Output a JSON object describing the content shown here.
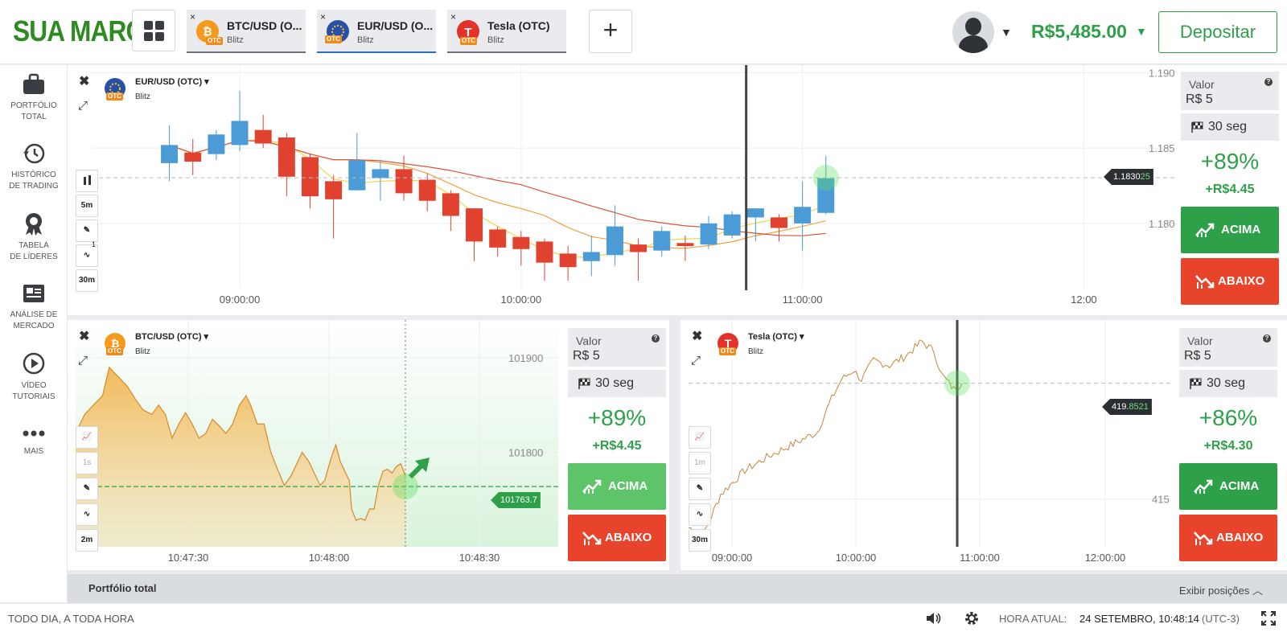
{
  "brand": {
    "logo": "SUA MARCA"
  },
  "tabs": [
    {
      "name": "BTC/USD (O...",
      "sub": "Blitz",
      "otc": "OTC"
    },
    {
      "name": "EUR/USD (O...",
      "sub": "Blitz",
      "otc": "OTC"
    },
    {
      "name": "Tesla (OTC)",
      "sub": "Blitz",
      "otc": "OTC"
    }
  ],
  "header": {
    "add_label": "+",
    "balance": "R$5,485.00",
    "deposit_label": "Depositar",
    "tab_close": "×"
  },
  "sidebar": {
    "items": [
      {
        "label1": "PORTFÓLIO",
        "label2": "TOTAL"
      },
      {
        "label1": "HISTÓRICO",
        "label2": "DE TRADING"
      },
      {
        "label1": "TABELA",
        "label2": "DE LÍDERES"
      },
      {
        "label1": "ANÁLISE DE",
        "label2": "MERCADO"
      },
      {
        "label1": "VÍDEO",
        "label2": "TUTORIAIS"
      },
      {
        "label1": "MAIS",
        "label2": ""
      }
    ]
  },
  "common": {
    "close": "✖",
    "expand": "⤢",
    "valor_label": "Valor",
    "help": "?",
    "up_label": "ACIMA",
    "down_label": "ABAIXO"
  },
  "panels": {
    "eurusd": {
      "name": "EUR/USD (OTC)",
      "sub": "Blitz",
      "otc": "OTC",
      "tools": [
        "5m",
        "30m"
      ],
      "tool_badge": "1",
      "price_prefix": "1.1830",
      "price_suffix": "25",
      "amount": "R$ 5",
      "duration": "30 seg",
      "payout": "+89%",
      "profit": "+R$4.45"
    },
    "btcusd": {
      "name": "BTC/USD (OTC)",
      "sub": "Blitz",
      "otc": "OTC",
      "tools": [
        "1s",
        "2m"
      ],
      "price_prefix": "1017",
      "price_suffix": "63.7",
      "amount": "R$ 5",
      "duration": "30 seg",
      "payout": "+89%",
      "profit": "+R$4.45"
    },
    "tesla": {
      "name": "Tesla (OTC)",
      "sub": "Blitz",
      "otc": "OTC",
      "tools": [
        "1m",
        "30m"
      ],
      "price_prefix": "419.",
      "price_suffix": "8521",
      "amount": "R$ 5",
      "duration": "30 seg",
      "payout": "+86%",
      "profit": "+R$4.30"
    }
  },
  "chart_data": [
    {
      "type": "candlestick",
      "series_name": "EUR/USD (OTC)",
      "x_ticks": [
        "09:00:00",
        "10:00:00",
        "11:00:00",
        "12:00"
      ],
      "y_ticks": [
        1.19,
        1.185,
        1.18
      ],
      "y_tick_labels": [
        "1.190",
        "1.185",
        "1.180"
      ],
      "ylim": [
        1.1745,
        1.1905
      ],
      "time_range_min": [
        505,
        740
      ],
      "current_price": 1.183025,
      "current_time_min": 648,
      "candles": [
        {
          "t": 525,
          "o": 1.184,
          "h": 1.1865,
          "l": 1.1828,
          "c": 1.1852
        },
        {
          "t": 530,
          "o": 1.1847,
          "h": 1.1856,
          "l": 1.1832,
          "c": 1.1841
        },
        {
          "t": 535,
          "o": 1.1846,
          "h": 1.1862,
          "l": 1.1842,
          "c": 1.1859
        },
        {
          "t": 540,
          "o": 1.1852,
          "h": 1.1888,
          "l": 1.1848,
          "c": 1.1868
        },
        {
          "t": 545,
          "o": 1.1862,
          "h": 1.1872,
          "l": 1.185,
          "c": 1.1853
        },
        {
          "t": 550,
          "o": 1.1857,
          "h": 1.186,
          "l": 1.1818,
          "c": 1.1831
        },
        {
          "t": 555,
          "o": 1.1844,
          "h": 1.1846,
          "l": 1.181,
          "c": 1.1818
        },
        {
          "t": 560,
          "o": 1.1828,
          "h": 1.1832,
          "l": 1.179,
          "c": 1.1816
        },
        {
          "t": 565,
          "o": 1.1822,
          "h": 1.186,
          "l": 1.1822,
          "c": 1.1842
        },
        {
          "t": 570,
          "o": 1.183,
          "h": 1.1842,
          "l": 1.1815,
          "c": 1.1836
        },
        {
          "t": 575,
          "o": 1.1836,
          "h": 1.1845,
          "l": 1.1815,
          "c": 1.182
        },
        {
          "t": 580,
          "o": 1.1829,
          "h": 1.1833,
          "l": 1.1808,
          "c": 1.1815
        },
        {
          "t": 585,
          "o": 1.182,
          "h": 1.1822,
          "l": 1.1795,
          "c": 1.1805
        },
        {
          "t": 590,
          "o": 1.181,
          "h": 1.181,
          "l": 1.1775,
          "c": 1.1788
        },
        {
          "t": 595,
          "o": 1.1796,
          "h": 1.1798,
          "l": 1.1778,
          "c": 1.1784
        },
        {
          "t": 600,
          "o": 1.1791,
          "h": 1.1795,
          "l": 1.1772,
          "c": 1.1783
        },
        {
          "t": 605,
          "o": 1.1788,
          "h": 1.179,
          "l": 1.1762,
          "c": 1.1774
        },
        {
          "t": 610,
          "o": 1.178,
          "h": 1.1785,
          "l": 1.1762,
          "c": 1.1771
        },
        {
          "t": 615,
          "o": 1.1775,
          "h": 1.1792,
          "l": 1.1765,
          "c": 1.1781
        },
        {
          "t": 620,
          "o": 1.1779,
          "h": 1.1812,
          "l": 1.1772,
          "c": 1.1798
        },
        {
          "t": 625,
          "o": 1.1786,
          "h": 1.179,
          "l": 1.1762,
          "c": 1.1781
        },
        {
          "t": 630,
          "o": 1.1782,
          "h": 1.1798,
          "l": 1.1778,
          "c": 1.1795
        },
        {
          "t": 635,
          "o": 1.1787,
          "h": 1.1792,
          "l": 1.1775,
          "c": 1.1785
        },
        {
          "t": 640,
          "o": 1.1786,
          "h": 1.1805,
          "l": 1.1783,
          "c": 1.18
        },
        {
          "t": 645,
          "o": 1.1792,
          "h": 1.1808,
          "l": 1.179,
          "c": 1.1806
        },
        {
          "t": 650,
          "o": 1.1804,
          "h": 1.1808,
          "l": 1.1788,
          "c": 1.181
        },
        {
          "t": 655,
          "o": 1.1804,
          "h": 1.1806,
          "l": 1.1788,
          "c": 1.1797
        },
        {
          "t": 660,
          "o": 1.18,
          "h": 1.1828,
          "l": 1.1782,
          "c": 1.1811
        },
        {
          "t": 665,
          "o": 1.1807,
          "h": 1.1845,
          "l": 1.1806,
          "c": 1.183
        }
      ]
    },
    {
      "type": "area",
      "series_name": "BTC/USD (OTC)",
      "x_ticks": [
        "10:47:30",
        "10:48:00",
        "10:48:30"
      ],
      "y_ticks": [
        101900,
        101800
      ],
      "ylim": [
        101700,
        101940
      ],
      "x_range_sec": [
        -10,
        105
      ],
      "current_price": 101763.7,
      "current_time_sec": 43,
      "points": [
        [
          -10,
          101820
        ],
        [
          -6,
          101840
        ],
        [
          -2,
          101850
        ],
        [
          2,
          101860
        ],
        [
          5,
          101890
        ],
        [
          9,
          101880
        ],
        [
          13,
          101870
        ],
        [
          17,
          101855
        ],
        [
          20,
          101845
        ],
        [
          24,
          101840
        ],
        [
          27,
          101850
        ],
        [
          30,
          101840
        ],
        [
          33,
          101815
        ],
        [
          36,
          101830
        ],
        [
          39,
          101842
        ],
        [
          42,
          101830
        ],
        [
          45,
          101815
        ],
        [
          48,
          101820
        ],
        [
          51,
          101835
        ],
        [
          54,
          101828
        ],
        [
          57,
          101820
        ],
        [
          60,
          101830
        ],
        [
          63,
          101850
        ],
        [
          66,
          101860
        ],
        [
          68,
          101850
        ],
        [
          71,
          101830
        ],
        [
          74,
          101830
        ],
        [
          77,
          101800
        ],
        [
          80,
          101782
        ],
        [
          83,
          101765
        ],
        [
          86,
          101775
        ],
        [
          89,
          101790
        ],
        [
          91,
          101800
        ],
        [
          94,
          101790
        ],
        [
          96,
          101780
        ],
        [
          99,
          101765
        ],
        [
          101,
          101770
        ],
        [
          104,
          101795
        ],
        [
          106,
          101808
        ],
        [
          108,
          101790
        ],
        [
          110,
          101780
        ],
        [
          112,
          101770
        ],
        [
          113,
          101740
        ],
        [
          115,
          101728
        ],
        [
          117,
          101730
        ],
        [
          119,
          101728
        ],
        [
          121,
          101740
        ],
        [
          123,
          101740
        ],
        [
          125,
          101765
        ],
        [
          127,
          101780
        ],
        [
          129,
          101782
        ],
        [
          131,
          101778
        ],
        [
          133,
          101785
        ],
        [
          135,
          101788
        ],
        [
          137,
          101775
        ]
      ]
    },
    {
      "type": "line",
      "series_name": "Tesla (OTC)",
      "x_ticks": [
        "09:00:00",
        "10:00:00",
        "11:00:00",
        "12:00:00"
      ],
      "y_ticks": [
        415
      ],
      "ylim": [
        413.0,
        422.5
      ],
      "current_price": 419.8521
    }
  ],
  "footer": {
    "portfolio_label": "Portfólio total",
    "show_positions": "Exibir posições",
    "tagline": "TODO DIA, A TODA HORA",
    "time_label": "HORA ATUAL:",
    "time_value": "24 SETEMBRO, 10:48:14",
    "timezone": "(UTC-3)"
  }
}
